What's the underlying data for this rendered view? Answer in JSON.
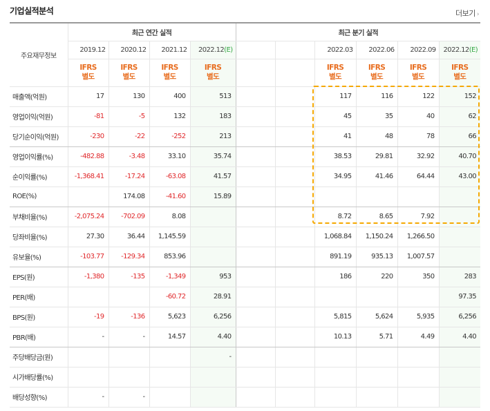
{
  "header": {
    "title": "기업실적분석",
    "more_label": "더보기",
    "more_icon": "chevron-right-icon"
  },
  "table": {
    "rowhead": "주요재무정보",
    "annual_title": "최근 연간 실적",
    "quarter_title": "최근 분기 실적",
    "annual_years": [
      "2019.12",
      "2020.12",
      "2021.12",
      "2022.12"
    ],
    "quarter_years": [
      "2022.03",
      "2022.06",
      "2022.09",
      "2022.12"
    ],
    "estimate_mark": "(E)",
    "ifrs_top": "IFRS",
    "ifrs_bottom": "별도",
    "rows": [
      {
        "label": "매출액(억원)",
        "a": [
          "17",
          "130",
          "400",
          "513"
        ],
        "q": [
          "117",
          "116",
          "122",
          "152"
        ]
      },
      {
        "label": "영업이익(억원)",
        "a": [
          "-81",
          "-5",
          "132",
          "183"
        ],
        "q": [
          "45",
          "35",
          "40",
          "62"
        ]
      },
      {
        "label": "당기순이익(억원)",
        "a": [
          "-230",
          "-22",
          "-252",
          "213"
        ],
        "q": [
          "41",
          "48",
          "78",
          "66"
        ]
      },
      {
        "label": "영업이익률(%)",
        "a": [
          "-482.88",
          "-3.48",
          "33.10",
          "35.74"
        ],
        "q": [
          "38.53",
          "29.81",
          "32.92",
          "40.70"
        ]
      },
      {
        "label": "순이익률(%)",
        "a": [
          "-1,368.41",
          "-17.24",
          "-63.08",
          "41.57"
        ],
        "q": [
          "34.95",
          "41.46",
          "64.44",
          "43.00"
        ]
      },
      {
        "label": "ROE(%)",
        "a": [
          "",
          "174.08",
          "-41.60",
          "15.89"
        ],
        "q": [
          "",
          "",
          "",
          ""
        ]
      },
      {
        "label": "부채비율(%)",
        "a": [
          "-2,075.24",
          "-702.09",
          "8.08",
          ""
        ],
        "q": [
          "8.72",
          "8.65",
          "7.92",
          ""
        ]
      },
      {
        "label": "당좌비율(%)",
        "a": [
          "27.30",
          "36.44",
          "1,145.59",
          ""
        ],
        "q": [
          "1,068.84",
          "1,150.24",
          "1,266.50",
          ""
        ]
      },
      {
        "label": "유보율(%)",
        "a": [
          "-103.77",
          "-129.34",
          "853.96",
          ""
        ],
        "q": [
          "891.19",
          "935.13",
          "1,007.57",
          ""
        ]
      },
      {
        "label": "EPS(원)",
        "a": [
          "-1,380",
          "-135",
          "-1,349",
          "953"
        ],
        "q": [
          "186",
          "220",
          "350",
          "283"
        ]
      },
      {
        "label": "PER(배)",
        "a": [
          "",
          "",
          "-60.72",
          "28.91"
        ],
        "q": [
          "",
          "",
          "",
          "97.35"
        ]
      },
      {
        "label": "BPS(원)",
        "a": [
          "-19",
          "-136",
          "5,623",
          "6,256"
        ],
        "q": [
          "5,815",
          "5,624",
          "5,935",
          "6,256"
        ]
      },
      {
        "label": "PBR(배)",
        "a": [
          "-",
          "-",
          "14.57",
          "4.40"
        ],
        "q": [
          "10.13",
          "5.71",
          "4.49",
          "4.40"
        ]
      },
      {
        "label": "주당배당금(원)",
        "a": [
          "",
          "",
          "",
          "-"
        ],
        "q": [
          "",
          "",
          "",
          ""
        ]
      },
      {
        "label": "시가배당률(%)",
        "a": [
          "",
          "",
          "",
          ""
        ],
        "q": [
          "",
          "",
          "",
          ""
        ]
      },
      {
        "label": "배당성향(%)",
        "a": [
          "-",
          "-",
          "",
          ""
        ],
        "q": [
          "",
          "",
          "",
          ""
        ]
      }
    ]
  },
  "colors": {
    "negative": "#e0272a",
    "ifrs": "#e86d1f",
    "estimate": "#36a845",
    "highlight": "#f5a800",
    "estimate_bg": "#f5fbf5"
  }
}
